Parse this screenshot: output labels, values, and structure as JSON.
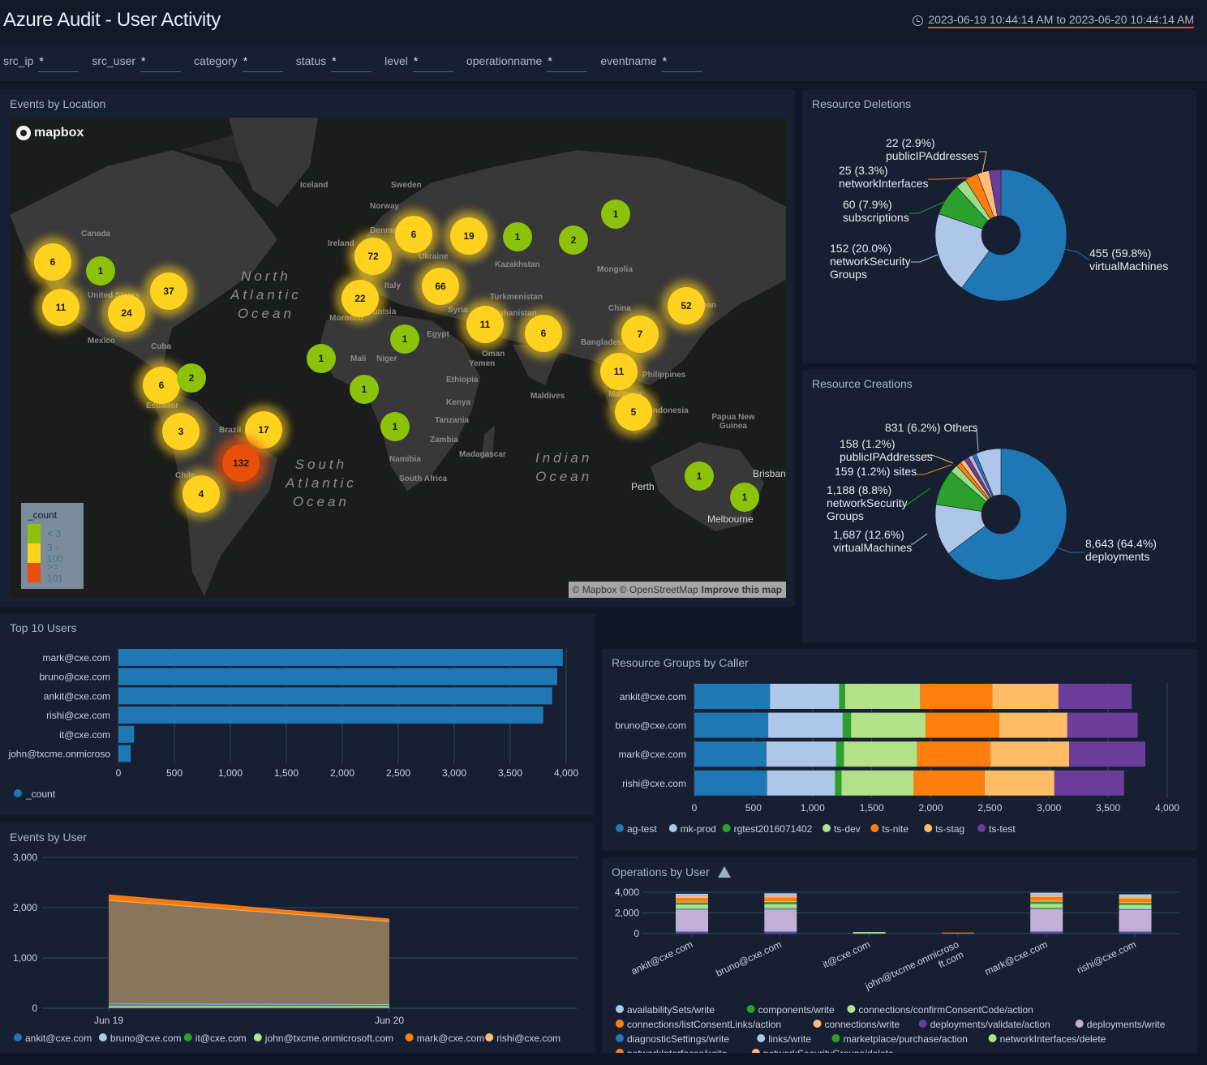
{
  "header": {
    "title": "Azure Audit - User Activity",
    "time_range": "2023-06-19 10:44:14 AM to 2023-06-20 10:44:14 AM",
    "clock_icon": "clock-icon"
  },
  "filters": [
    {
      "label": "src_ip",
      "value": "*"
    },
    {
      "label": "src_user",
      "value": "*"
    },
    {
      "label": "category",
      "value": "*"
    },
    {
      "label": "status",
      "value": "*"
    },
    {
      "label": "level",
      "value": "*"
    },
    {
      "label": "operationname",
      "value": "*"
    },
    {
      "label": "eventname",
      "value": "*"
    }
  ],
  "events_by_location": {
    "title": "Events by Location",
    "logo": "mapbox",
    "attribution": "© Mapbox © OpenStreetMap",
    "improve_link": "Improve this map",
    "legend": {
      "title": "_count",
      "items": [
        {
          "label": "< 3",
          "color": "#8cc20a"
        },
        {
          "label": "3 - 100",
          "color": "#ffd21f"
        },
        {
          "label": ">= 101",
          "color": "#e94e0c"
        }
      ]
    },
    "country_labels": [
      "Canada",
      "United States",
      "Mexico",
      "Cuba",
      "Ecuador",
      "Brazil",
      "Chile",
      "Iceland",
      "Sweden",
      "Norway",
      "Denmark",
      "Ireland",
      "Ukraine",
      "Italy",
      "Tunisia",
      "Morocco",
      "Kazakhstan",
      "Mongolia",
      "Turkmenistan",
      "Syria",
      "Afghanistan",
      "Egypt",
      "China",
      "Japan",
      "Bangladesh",
      "Oman",
      "Yemen",
      "Mali",
      "Niger",
      "Ethiopia",
      "Philippines",
      "Malaysia",
      "Indonesia",
      "Maldives",
      "Kenya",
      "Tanzania",
      "Zambia",
      "Namibia",
      "Madagascar",
      "South Africa",
      "Papua New Guinea"
    ],
    "oceans": [
      "North\nAtlantic\nOcean",
      "South\nAtlantic\nOcean",
      "Indian\nOcean"
    ],
    "cities": [
      "Perth",
      "Brisbane",
      "Melbourne"
    ],
    "clusters": [
      {
        "count": 6,
        "level": "mid"
      },
      {
        "count": 1,
        "level": "low"
      },
      {
        "count": 37,
        "level": "mid"
      },
      {
        "count": 11,
        "level": "mid"
      },
      {
        "count": 24,
        "level": "mid"
      },
      {
        "count": 72,
        "level": "mid"
      },
      {
        "count": 6,
        "level": "mid"
      },
      {
        "count": 19,
        "level": "mid"
      },
      {
        "count": 1,
        "level": "low"
      },
      {
        "count": 2,
        "level": "low"
      },
      {
        "count": 1,
        "level": "low"
      },
      {
        "count": 22,
        "level": "mid"
      },
      {
        "count": 66,
        "level": "mid"
      },
      {
        "count": 52,
        "level": "mid"
      },
      {
        "count": 11,
        "level": "mid"
      },
      {
        "count": 6,
        "level": "mid"
      },
      {
        "count": 7,
        "level": "mid"
      },
      {
        "count": 1,
        "level": "low"
      },
      {
        "count": 1,
        "level": "low"
      },
      {
        "count": 11,
        "level": "mid"
      },
      {
        "count": 1,
        "level": "low"
      },
      {
        "count": 6,
        "level": "mid"
      },
      {
        "count": 2,
        "level": "low"
      },
      {
        "count": 5,
        "level": "mid"
      },
      {
        "count": 3,
        "level": "mid"
      },
      {
        "count": 17,
        "level": "mid"
      },
      {
        "count": 1,
        "level": "low"
      },
      {
        "count": 132,
        "level": "high"
      },
      {
        "count": 4,
        "level": "mid"
      },
      {
        "count": 1,
        "level": "low"
      },
      {
        "count": 1,
        "level": "low"
      }
    ]
  },
  "chart_data": [
    {
      "id": "resource_deletions",
      "type": "pie",
      "title": "Resource Deletions",
      "slices": [
        {
          "label": "virtualMachines",
          "value": 455,
          "pct": "59.8%",
          "color": "#1f77b4",
          "text": "455 (59.8%)"
        },
        {
          "label": "networkSecurityGroups",
          "value": 152,
          "pct": "20.0%",
          "color": "#aec7e8",
          "text": "152 (20.0%)"
        },
        {
          "label": "subscriptions",
          "value": 60,
          "pct": "7.9%",
          "color": "#2ca02c",
          "text": "60 (7.9%)"
        },
        {
          "label": "",
          "value": 20,
          "pct": "",
          "color": "#98df8a",
          "text": ""
        },
        {
          "label": "networkInterfaces",
          "value": 25,
          "pct": "3.3%",
          "color": "#ff7f0e",
          "text": "25 (3.3%)"
        },
        {
          "label": "publicIPAddresses",
          "value": 22,
          "pct": "2.9%",
          "color": "#ffbb78",
          "text": "22 (2.9%)"
        },
        {
          "label": "",
          "value": 22,
          "pct": "",
          "color": "#6a3d9a",
          "text": ""
        }
      ]
    },
    {
      "id": "resource_creations",
      "type": "pie",
      "title": "Resource Creations",
      "slices": [
        {
          "label": "deployments",
          "value": 8643,
          "pct": "64.4%",
          "color": "#1f77b4",
          "text": "8,643 (64.4%)"
        },
        {
          "label": "virtualMachines",
          "value": 1687,
          "pct": "12.6%",
          "color": "#aec7e8",
          "text": "1,687 (12.6%)"
        },
        {
          "label": "networkSecurityGroups",
          "value": 1188,
          "pct": "8.8%",
          "color": "#2ca02c",
          "text": "1,188 (8.8%)"
        },
        {
          "label": "",
          "value": 260,
          "pct": "",
          "color": "#98df8a",
          "text": ""
        },
        {
          "label": "sites",
          "value": 159,
          "pct": "1.2%",
          "color": "#ff7f0e",
          "text": "159 (1.2%)"
        },
        {
          "label": "publicIPAddresses",
          "value": 158,
          "pct": "1.2%",
          "color": "#ffbb78",
          "text": "158 (1.2%)"
        },
        {
          "label": "",
          "value": 150,
          "pct": "",
          "color": "#6a3d9a",
          "text": ""
        },
        {
          "label": "",
          "value": 140,
          "pct": "",
          "color": "#c5b0d5",
          "text": ""
        },
        {
          "label": "",
          "value": 130,
          "pct": "",
          "color": "#1f77b4",
          "text": ""
        },
        {
          "label": "Others",
          "value": 831,
          "pct": "6.2%",
          "color": "#aec7e8",
          "text": "831 (6.2%)"
        }
      ]
    },
    {
      "id": "top_10_users",
      "type": "bar",
      "title": "Top 10 Users",
      "orientation": "horizontal",
      "categories": [
        "mark@cxe.com",
        "bruno@cxe.com",
        "ankit@cxe.com",
        "rishi@cxe.com",
        "it@cxe.com",
        "john@txcme.onmicrosoft.com"
      ],
      "values": [
        3970,
        3920,
        3875,
        3795,
        140,
        110
      ],
      "xlim": [
        0,
        4000
      ],
      "xticks": [
        "0",
        "500",
        "1,000",
        "1,500",
        "2,000",
        "2,500",
        "3,000",
        "3,500",
        "4,000"
      ],
      "legend": [
        {
          "name": "_count",
          "color": "#1f77b4"
        }
      ],
      "grid": true
    },
    {
      "id": "resource_groups_by_caller",
      "type": "bar",
      "title": "Resource Groups by Caller",
      "orientation": "horizontal",
      "stacked": true,
      "categories": [
        "ankit@cxe.com",
        "bruno@cxe.com",
        "mark@cxe.com",
        "rishi@cxe.com"
      ],
      "series": [
        {
          "name": "ag-test",
          "color": "#1f77b4",
          "values": [
            640,
            625,
            610,
            615
          ]
        },
        {
          "name": "mk-prod",
          "color": "#aec7e8",
          "values": [
            585,
            630,
            590,
            575
          ]
        },
        {
          "name": "rgtest2016071402",
          "color": "#2ca02c",
          "values": [
            50,
            70,
            65,
            55
          ]
        },
        {
          "name": "ts-dev",
          "color": "#b5e08a",
          "values": [
            635,
            630,
            620,
            610
          ]
        },
        {
          "name": "ts-nite",
          "color": "#ff7f0e",
          "values": [
            610,
            625,
            620,
            600
          ]
        },
        {
          "name": "ts-stag",
          "color": "#ffbb66",
          "values": [
            560,
            575,
            665,
            590
          ]
        },
        {
          "name": "ts-test",
          "color": "#6a3d9a",
          "values": [
            620,
            595,
            645,
            590
          ]
        }
      ],
      "xlim": [
        0,
        4000
      ],
      "xticks": [
        "0",
        "500",
        "1,000",
        "1,500",
        "2,000",
        "2,500",
        "3,000",
        "3,500",
        "4,000"
      ],
      "legend_position": "bottom",
      "grid": true
    },
    {
      "id": "events_by_user",
      "type": "area",
      "title": "Events by User",
      "stacked": true,
      "x": [
        "Jun 19",
        "Jun 20"
      ],
      "series": [
        {
          "name": "ankit@cxe.com",
          "color": "#1f77b4",
          "values": [
            10,
            10
          ]
        },
        {
          "name": "bruno@cxe.com",
          "color": "#aec7e8",
          "values": [
            10,
            10
          ]
        },
        {
          "name": "it@cxe.com",
          "color": "#2ca02c",
          "values": [
            20,
            15
          ]
        },
        {
          "name": "john@txcme.onmicrosoft.com",
          "color": "#b5e08a",
          "values": [
            50,
            45
          ]
        },
        {
          "name": "mark@cxe.com",
          "color": "#ff7f0e",
          "values": [
            100,
            40
          ]
        },
        {
          "name": "rishi@cxe.com",
          "color": "#ffbb78",
          "values": [
            2060,
            1650
          ]
        }
      ],
      "ylim": [
        0,
        3000
      ],
      "yticks": [
        "0",
        "1,000",
        "2,000",
        "3,000"
      ],
      "legend_position": "bottom",
      "grid": true
    },
    {
      "id": "operations_by_user",
      "type": "bar",
      "title": "Operations by User",
      "warning_icon": "warning-icon",
      "stacked": true,
      "categories": [
        "ankit@cxe.com",
        "bruno@cxe.com",
        "it@cxe.com",
        "john@txcme.onmicrosoft.com",
        "mark@cxe.com",
        "rishi@cxe.com"
      ],
      "totals": [
        3850,
        3900,
        150,
        100,
        3950,
        3800
      ],
      "ylim": [
        0,
        4000
      ],
      "yticks": [
        "0",
        "2,000",
        "4,000"
      ],
      "legend": [
        {
          "name": "availabilitySets/write",
          "color": "#aec7e8"
        },
        {
          "name": "components/write",
          "color": "#2ca02c"
        },
        {
          "name": "connections/confirmConsentCode/action",
          "color": "#b5e08a"
        },
        {
          "name": "connections/listConsentLinks/action",
          "color": "#ff7f0e"
        },
        {
          "name": "connections/write",
          "color": "#ffbb78"
        },
        {
          "name": "deployments/validate/action",
          "color": "#6a3d9a"
        },
        {
          "name": "deployments/write",
          "color": "#c5b0d5"
        },
        {
          "name": "diagnosticSettings/write",
          "color": "#1f77b4"
        },
        {
          "name": "links/write",
          "color": "#aec7e8"
        },
        {
          "name": "marketplace/purchase/action",
          "color": "#2ca02c"
        },
        {
          "name": "networkInterfaces/delete",
          "color": "#b5e08a"
        },
        {
          "name": "networkInterfaces/write",
          "color": "#ff7f0e"
        },
        {
          "name": "networkSecurityGroups/delete",
          "color": "#ffbb78"
        }
      ],
      "grid": true
    }
  ]
}
